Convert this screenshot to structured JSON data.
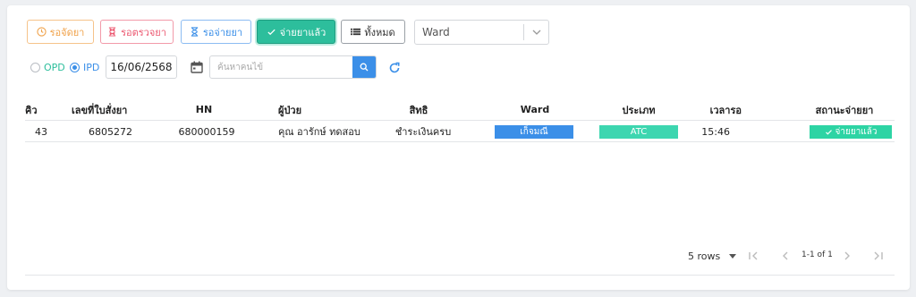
{
  "filters": {
    "wait_arrange": "รอจัดยา",
    "wait_check": "รอตรวจยา",
    "wait_dispense": "รอจ่ายยา",
    "dispensed": "จ่ายยาแล้ว",
    "all": "ทั้งหมด"
  },
  "ward_select": {
    "value": "Ward"
  },
  "patient_type": {
    "opd": "OPD",
    "ipd": "IPD",
    "selected": "IPD"
  },
  "date": "16/06/2568",
  "search": {
    "placeholder": "ค้นหาคนไข้",
    "value": ""
  },
  "table": {
    "headers": {
      "queue": "คิว",
      "order_no": "เลขที่ใบสั่งยา",
      "hn": "HN",
      "patient": "ผู้ป่วย",
      "right": "สิทธิ",
      "ward": "Ward",
      "type": "ประเภท",
      "wait_time": "เวลารอ",
      "status": "สถานะจ่ายยา"
    },
    "rows": [
      {
        "queue": "43",
        "order_no": "6805272",
        "hn": "680000159",
        "patient": "คุณ อารักษ์ ทดสอบ",
        "right": "ชำระเงินครบ",
        "ward": "เก็จมณี",
        "type": "ATC",
        "wait_time": "15:46",
        "status": "จ่ายยาแล้ว"
      }
    ]
  },
  "pagination": {
    "rows_per_page": "5 rows",
    "range": "1-1 of 1"
  },
  "colors": {
    "orange": "#f0a24a",
    "pink": "#ec5a72",
    "blue": "#3b8fe8",
    "teal": "#2dbe9c",
    "ward_pill": "#3b8fe8",
    "type_pill": "#3dd6b0",
    "status_pill": "#2dd4a4"
  }
}
